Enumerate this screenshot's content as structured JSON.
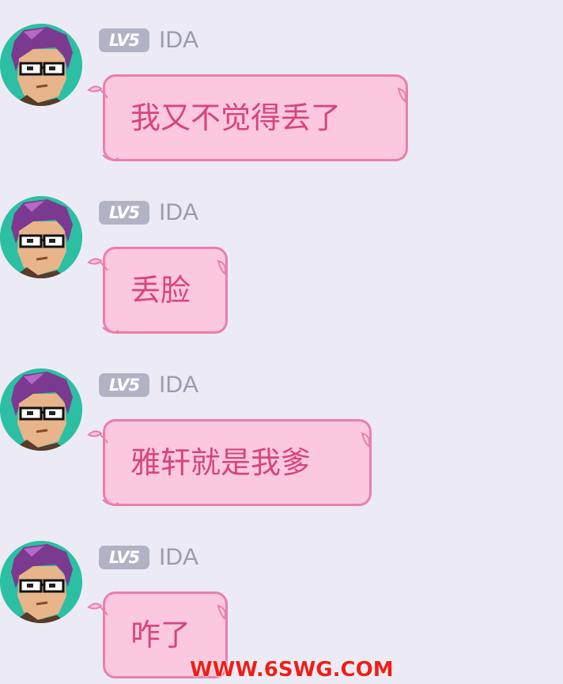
{
  "messages": [
    {
      "level": "LV5",
      "username": "IDA",
      "text": "我又不觉得丢了"
    },
    {
      "level": "LV5",
      "username": "IDA",
      "text": "丢脸"
    },
    {
      "level": "LV5",
      "username": "IDA",
      "text": "雅轩就是我爹"
    },
    {
      "level": "LV5",
      "username": "IDA",
      "text": "咋了"
    }
  ],
  "watermark": "WWW.6SWG.COM",
  "colors": {
    "background": "#ecebf5",
    "bubble_fill": "#fbc8e0",
    "bubble_border": "#ea7fab",
    "bubble_text": "#d7457b",
    "badge": "#b1b3c4",
    "username": "#9a9bad",
    "avatar_bg": "#2cbfa3",
    "watermark": "#f01e18"
  },
  "icons": {
    "avatar": "pixel-art-avatar-purple-hair-glasses",
    "bubble_decoration": "ribbon-leaf-icon"
  }
}
